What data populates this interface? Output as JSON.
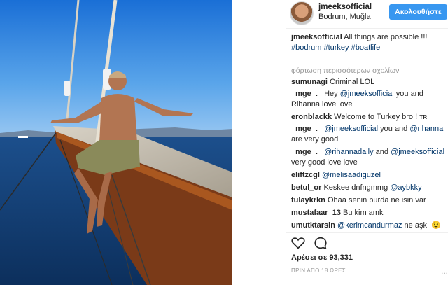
{
  "post": {
    "username": "jmeeksofficial",
    "location": "Bodrum, Muğla",
    "follow_label": "Ακολουθήστε",
    "caption_user": "jmeeksofficial",
    "caption_text": "All things are possible !!!",
    "hashtags": "#bodrum #turkey #boatlife",
    "load_more": "φόρτωση περισσότερων σχολίων",
    "likes": "Αρέσει σε 93,331",
    "time": "ΠΡΙΝ ΑΠΟ 18 ΩΡΕΣ",
    "more_menu": "...",
    "accent_color": "#3897f0"
  },
  "comments": [
    {
      "user": "sumunagi",
      "text": "Criminal LOL"
    },
    {
      "user": "_mge_._",
      "pre": "Hey ",
      "mention": "@jmeeksofficial",
      "post": " you and Rihanna love love"
    },
    {
      "user": "eronblackk",
      "text": "Welcome to Turkey bro ! ᴛʀ"
    },
    {
      "user": "_mge_._",
      "mention": "@jmeeksofficial",
      "post": " you and ",
      "mention2": "@rihanna",
      "post2": " are very good"
    },
    {
      "user": "_mge_._",
      "mention": "@rihannadaily",
      "post": " and ",
      "mention2": "@jmeeksofficial",
      "post2": " very good love love"
    },
    {
      "user": "eliftzcgl",
      "mention": "@melisaadiguzel"
    },
    {
      "user": "betul_or",
      "text": "Keskee dnfngmmg ",
      "mention": "@aybkky"
    },
    {
      "user": "tulaykrkn",
      "text": "Ohaa senin burda ne isin var"
    },
    {
      "user": "mustafaar_13",
      "text": "Bu kim amk"
    },
    {
      "user": "umutktarsln",
      "mention": "@kerimcandurmaz",
      "post": " ne aşkı 😉"
    }
  ]
}
